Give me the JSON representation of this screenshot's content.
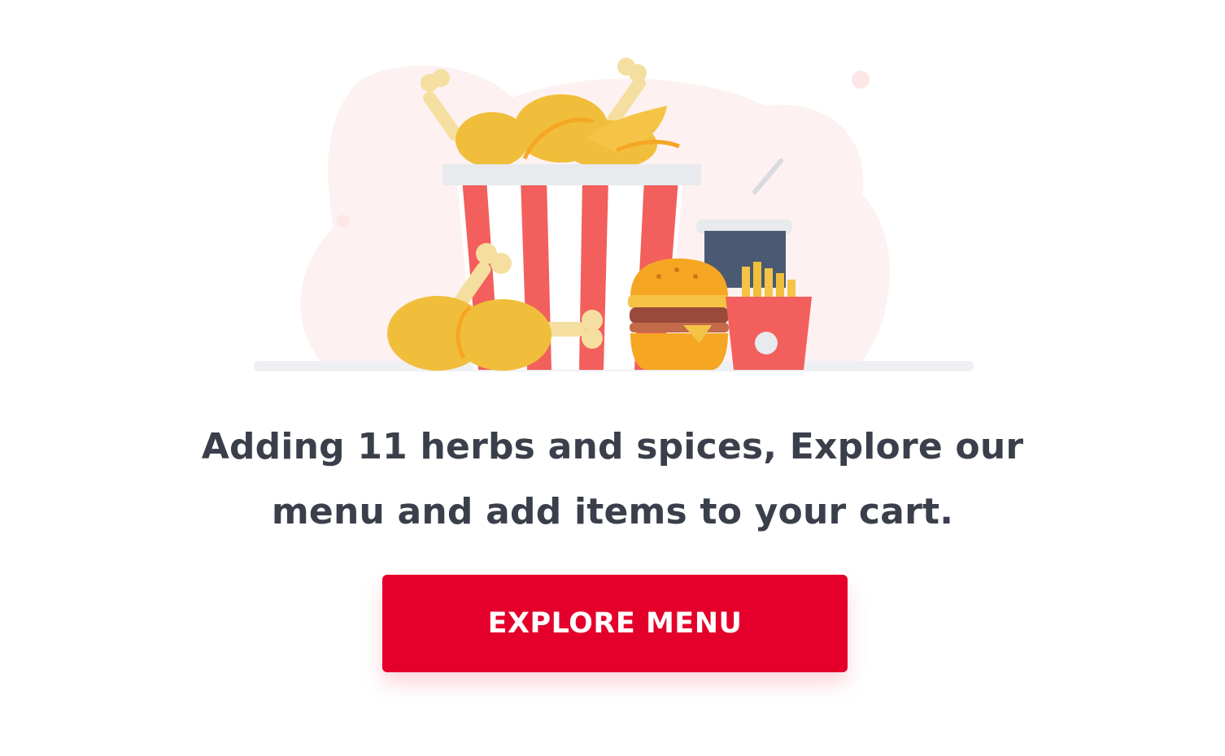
{
  "empty_state": {
    "illustration_icon": "bucket-meal-illustration",
    "message_line1": "Adding 11 herbs and spices, Explore our",
    "message_line2": "menu and add items to your cart.",
    "cta_label": "EXPLORE MENU"
  },
  "colors": {
    "accent": "#e4002b",
    "text": "#3a3f4b",
    "bucket_stripe": "#f25f5c",
    "chicken": "#f0be3a",
    "bone": "#f5dfa0"
  }
}
